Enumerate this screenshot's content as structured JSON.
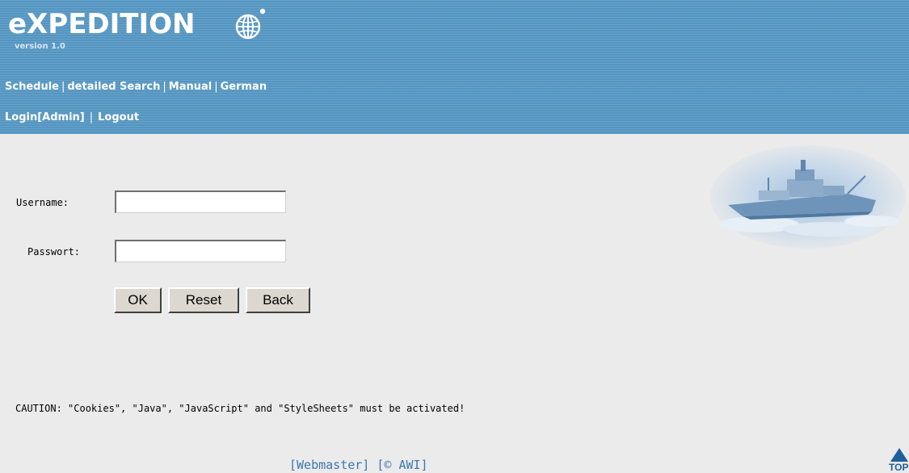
{
  "header": {
    "logo_title": "eXPEDITION",
    "logo_version": "version 1.0",
    "nav_row1": [
      {
        "label": "Schedule"
      },
      {
        "label": "detailed Search"
      },
      {
        "label": "Manual"
      },
      {
        "label": "German"
      }
    ],
    "nav_row2": [
      {
        "label": "Login[Admin]"
      },
      {
        "label": "Logout"
      }
    ],
    "separator": "|"
  },
  "login_form": {
    "username_label": "Username:",
    "username_value": "",
    "password_label": "Passwort:",
    "password_value": "",
    "ok_label": "OK",
    "reset_label": "Reset",
    "back_label": "Back"
  },
  "caution_text": "CAUTION: \"Cookies\", \"Java\", \"JavaScript\" and \"StyleSheets\" must be activated!",
  "footer": {
    "webmaster_label": "[Webmaster]",
    "awi_label": "[© AWI]"
  },
  "top_link": {
    "label": "TOP",
    "icon": "up-arrow-icon"
  },
  "colors": {
    "header_bg": "#5596c2",
    "page_bg": "#ebebeb",
    "footer_link": "#3a78b0",
    "top_arrow": "#1f5f9c"
  }
}
